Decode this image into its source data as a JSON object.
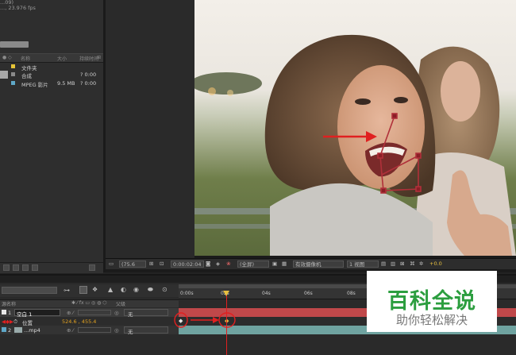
{
  "project": {
    "info_line1": "...09)",
    "info_line2": "..., 23.976 fps",
    "columns": [
      "名称",
      "大小",
      "持续时间"
    ],
    "items": [
      {
        "name": "文件夹",
        "size": "",
        "duration": "",
        "color": "#e6c437"
      },
      {
        "name": "合成",
        "size": "",
        "duration": "? 0:00",
        "color": "#8a8a8a"
      },
      {
        "name": "MPEG 影片",
        "size": "9.5 MB",
        "duration": "? 0:00",
        "color": "#5fa7c7"
      }
    ]
  },
  "viewer": {
    "zoom": "(75.6",
    "timecode": "0:00:02:04",
    "resolution": "(全屏)",
    "camera": "有效摄像机",
    "views": "1 视图",
    "exposure": "+0.0"
  },
  "timeline": {
    "col_name": "源名称",
    "col_parent": "父级",
    "layers": [
      {
        "num": "1",
        "name": "空白 1",
        "parent": "无"
      },
      {
        "prop": "位置",
        "value": "524.6 , 455.4"
      },
      {
        "num": "2",
        "name": "...mp4",
        "parent": "无"
      }
    ],
    "ruler_labels": [
      "0:00s",
      "02s",
      "04s",
      "06s",
      "08s",
      "10s",
      "12s",
      "14s"
    ]
  },
  "watermark": {
    "title": "百科全说",
    "subtitle": "助你轻松解决"
  },
  "colors": {
    "label_yellow": "#e6c437",
    "track_red": "#c0484a",
    "track_teal": "#6fa3a0",
    "annotation_red": "#e02020",
    "brand_green": "#2c9e3f"
  }
}
